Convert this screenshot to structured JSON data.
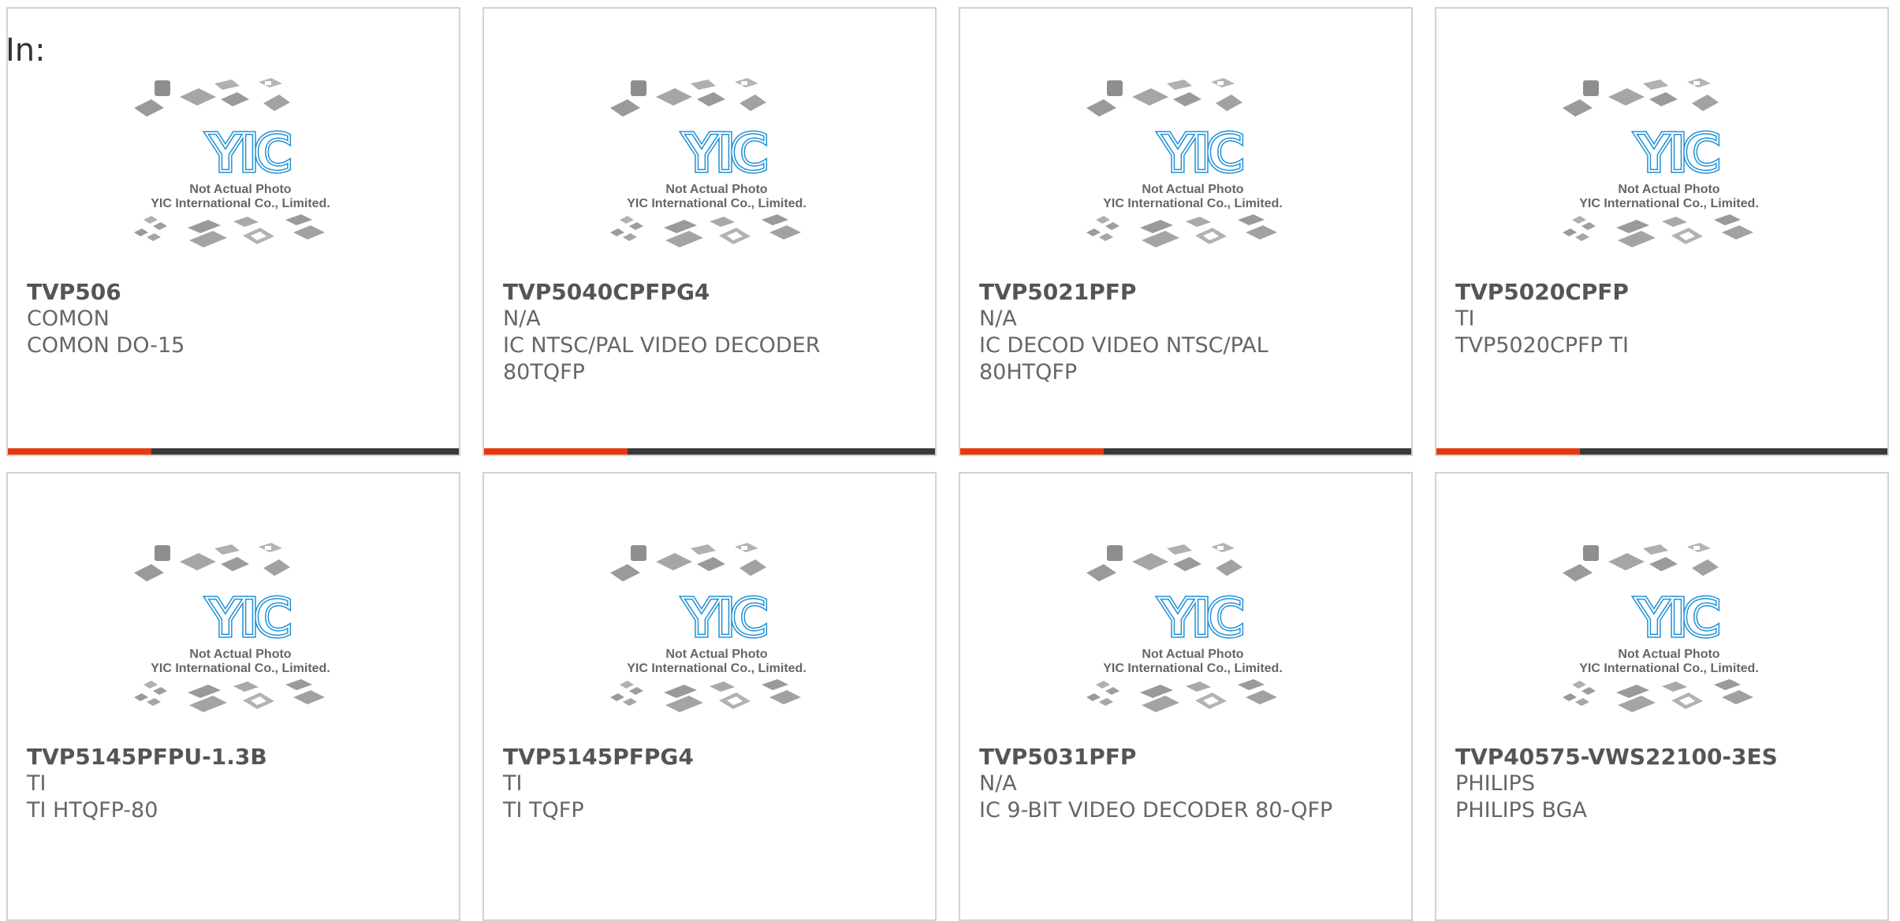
{
  "header": {
    "label": "In:"
  },
  "watermark": {
    "line1": "Not Actual Photo",
    "line2": "YIC International Co., Limited.",
    "logo_text": "YIC",
    "logo_color": "#1e90d6",
    "logo_color_dark": "#0b5f9c",
    "chip_color": "#9a9a9a"
  },
  "colors": {
    "accent": "#e8380d",
    "bar": "#3a3a3a",
    "border": "#d2d2d2",
    "text_dark": "#555555",
    "text": "#666666"
  },
  "products": [
    {
      "part_number": "TVP506",
      "manufacturer": "COMON",
      "description": "COMON DO-15",
      "has_bar": true
    },
    {
      "part_number": "TVP5040CPFPG4",
      "manufacturer": "N/A",
      "description": "IC NTSC/PAL VIDEO DECODER 80TQFP",
      "has_bar": true
    },
    {
      "part_number": "TVP5021PFP",
      "manufacturer": "N/A",
      "description": "IC DECOD VIDEO NTSC/PAL 80HTQFP",
      "has_bar": true
    },
    {
      "part_number": "TVP5020CPFP",
      "manufacturer": "TI",
      "description": "TVP5020CPFP TI",
      "has_bar": true
    },
    {
      "part_number": "TVP5145PFPU-1.3B",
      "manufacturer": "TI",
      "description": "TI HTQFP-80",
      "has_bar": false
    },
    {
      "part_number": "TVP5145PFPG4",
      "manufacturer": "TI",
      "description": "TI TQFP",
      "has_bar": false
    },
    {
      "part_number": "TVP5031PFP",
      "manufacturer": "N/A",
      "description": "IC 9-BIT VIDEO DECODER 80-QFP",
      "has_bar": false
    },
    {
      "part_number": "TVP40575-VWS22100-3ES",
      "manufacturer": "PHILIPS",
      "description": "PHILIPS BGA",
      "has_bar": false
    }
  ]
}
